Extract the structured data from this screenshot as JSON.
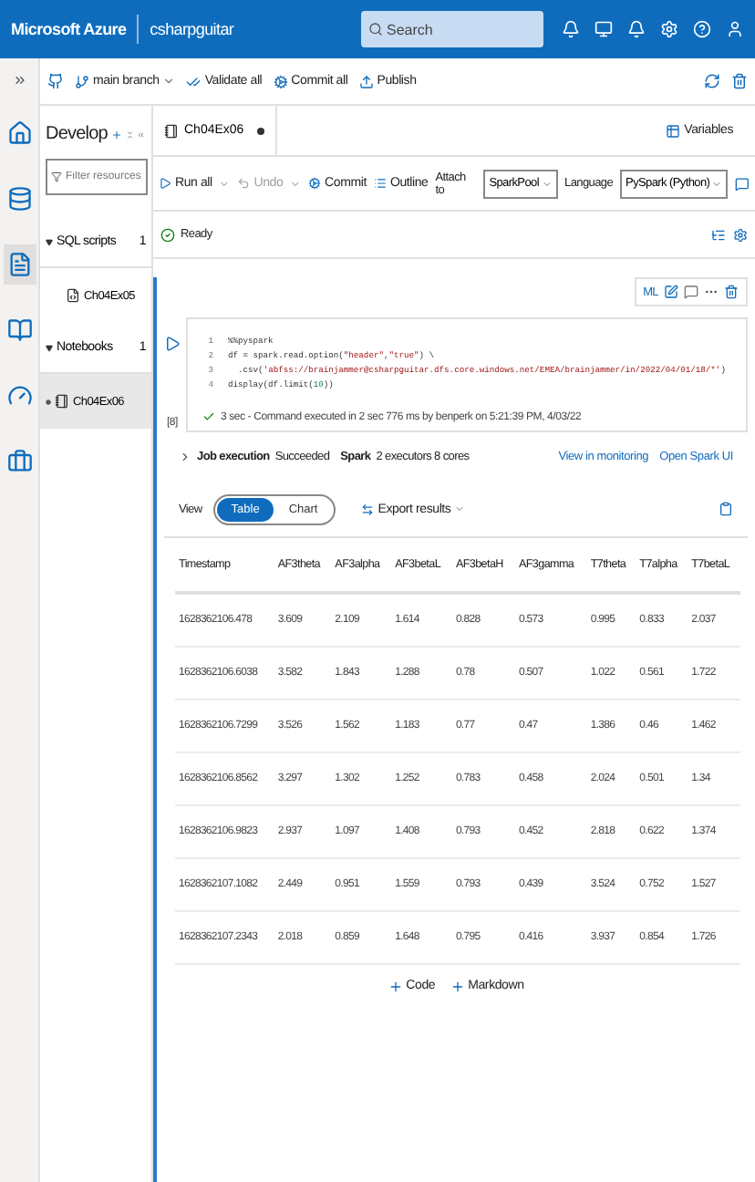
{
  "header": {
    "brand": "Microsoft Azure",
    "workspace": "csharpguitar",
    "search": {
      "placeholder": "Search"
    }
  },
  "rail": [
    {
      "selected": false
    },
    {
      "selected": false
    },
    {
      "selected": true
    },
    {
      "selected": false
    },
    {
      "selected": false
    },
    {
      "selected": false
    }
  ],
  "toolbar": {
    "branch": "main branch",
    "actions": [
      "Validate all",
      "Commit all",
      "Publish"
    ]
  },
  "develop": {
    "title": "Develop",
    "filter": {
      "placeholder": "Filter resources"
    },
    "groups": [
      {
        "label": "SQL scripts",
        "count": "1",
        "expanded": true,
        "items": [
          {
            "label": "Ch04Ex05",
            "selected": false
          }
        ]
      },
      {
        "label": "Notebooks",
        "count": "1",
        "expanded": true,
        "items": [
          {
            "label": "Ch04Ex06",
            "selected": true
          }
        ]
      }
    ]
  },
  "tab": {
    "label": "Ch04Ex06",
    "modified": true
  },
  "variables": "Variables",
  "notebook_toolbar": {
    "run_all": "Run all",
    "undo": {
      "label": "Undo",
      "disabled": true
    },
    "commit": "Commit",
    "outline": "Outline",
    "attach_label": "Attach to",
    "attach_value": "SparkPool",
    "language_label": "Language",
    "language_value": "PySpark (Python)"
  },
  "status": {
    "label": "Ready",
    "ok": true
  },
  "cell_toolbar": {
    "ml": "ML"
  },
  "cell": {
    "execution_count": "[8]",
    "lines": [
      {
        "number": "1",
        "segments": [
          {
            "kind": "plain",
            "text": "%%pyspark"
          }
        ]
      },
      {
        "number": "2",
        "segments": [
          {
            "kind": "plain",
            "text": "df = spark.read.option("
          },
          {
            "kind": "string",
            "text": "\"header\""
          },
          {
            "kind": "plain",
            "text": ","
          },
          {
            "kind": "string",
            "text": "\"true\""
          },
          {
            "kind": "plain",
            "text": ") \\"
          }
        ]
      },
      {
        "number": "3",
        "segments": [
          {
            "kind": "plain",
            "text": "  .csv("
          },
          {
            "kind": "string",
            "text": "'abfss://brainjammer@csharpguitar.dfs.core.windows.net/EMEA/brainjammer/in/2022/04/01/18/*'"
          },
          {
            "kind": "plain",
            "text": ")"
          }
        ]
      },
      {
        "number": "4",
        "segments": [
          {
            "kind": "plain",
            "text": "display(df.limit("
          },
          {
            "kind": "number",
            "text": "10"
          },
          {
            "kind": "plain",
            "text": "))"
          }
        ]
      }
    ],
    "summary": "3 sec - Command executed in 2 sec 776 ms by benperk on 5:21:39 PM, 4/03/22"
  },
  "job": {
    "label": "Job execution",
    "status": "Succeeded",
    "spark_label": "Spark",
    "spark_info": "2 executors 8 cores",
    "links": [
      "View in monitoring",
      "Open Spark UI"
    ]
  },
  "view": {
    "label": "View",
    "options": [
      {
        "label": "Table",
        "selected": true
      },
      {
        "label": "Chart",
        "selected": false
      }
    ],
    "export": "Export results"
  },
  "table": {
    "columns": [
      "Timestamp",
      "AF3theta",
      "AF3alpha",
      "AF3betaL",
      "AF3betaH",
      "AF3gamma",
      "T7theta",
      "T7alpha",
      "T7betaL"
    ],
    "rows": [
      [
        "1628362106.478",
        "3.609",
        "2.109",
        "1.614",
        "0.828",
        "0.573",
        "0.995",
        "0.833",
        "2.037"
      ],
      [
        "1628362106.6038",
        "3.582",
        "1.843",
        "1.288",
        "0.78",
        "0.507",
        "1.022",
        "0.561",
        "1.722"
      ],
      [
        "1628362106.7299",
        "3.526",
        "1.562",
        "1.183",
        "0.77",
        "0.47",
        "1.386",
        "0.46",
        "1.462"
      ],
      [
        "1628362106.8562",
        "3.297",
        "1.302",
        "1.252",
        "0.783",
        "0.458",
        "2.024",
        "0.501",
        "1.34"
      ],
      [
        "1628362106.9823",
        "2.937",
        "1.097",
        "1.408",
        "0.793",
        "0.452",
        "2.818",
        "0.622",
        "1.374"
      ],
      [
        "1628362107.1082",
        "2.449",
        "0.951",
        "1.559",
        "0.793",
        "0.439",
        "3.524",
        "0.752",
        "1.527"
      ],
      [
        "1628362107.2343",
        "2.018",
        "0.859",
        "1.648",
        "0.795",
        "0.416",
        "3.937",
        "0.854",
        "1.726"
      ]
    ]
  },
  "add": [
    "Code",
    "Markdown"
  ]
}
